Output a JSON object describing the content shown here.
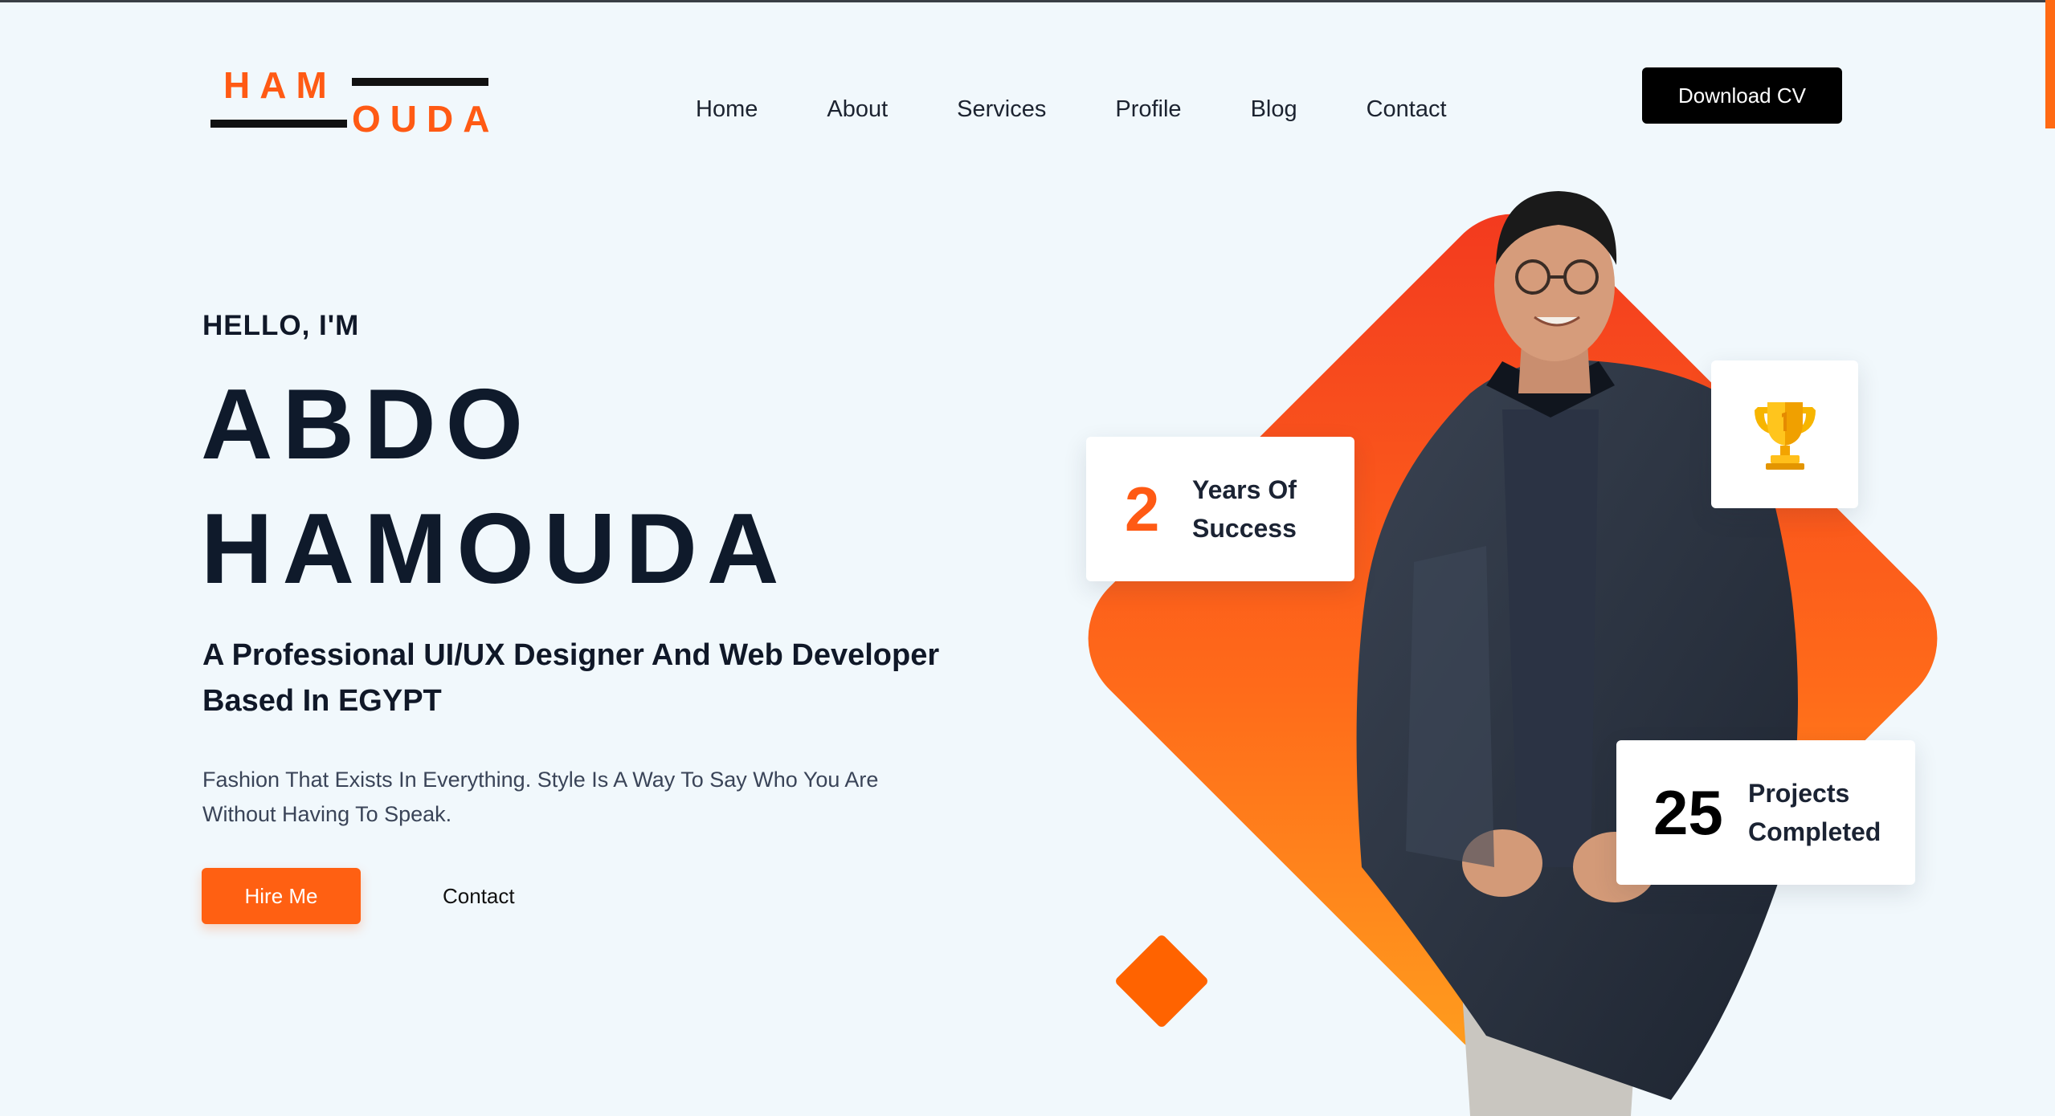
{
  "brand": {
    "logo_top": "HAM",
    "logo_bottom": "OUDA",
    "accent_color": "#ff5a14",
    "dark_color": "#0f1a2b"
  },
  "nav": {
    "items": [
      {
        "label": "Home"
      },
      {
        "label": "About"
      },
      {
        "label": "Services"
      },
      {
        "label": "Profile"
      },
      {
        "label": "Blog"
      },
      {
        "label": "Contact"
      }
    ],
    "cta_label": "Download CV"
  },
  "hero": {
    "greeting": "HELLO, I'M",
    "first_name": "ABDO",
    "last_name": "HAMOUDA",
    "tagline": "A Professional UI/UX Designer And Web Developer Based In EGYPT",
    "description": "Fashion That Exists In Everything. Style Is A Way To Say Who You Are Without Having To Speak.",
    "primary_button": "Hire Me",
    "secondary_link": "Contact"
  },
  "stats": {
    "years": {
      "value": "2",
      "label_line1": "Years Of",
      "label_line2": "Success"
    },
    "projects": {
      "value": "25",
      "label_line1": "Projects",
      "label_line2": "Completed"
    }
  },
  "icons": {
    "trophy": "trophy-icon",
    "portrait": "portrait-photo"
  }
}
